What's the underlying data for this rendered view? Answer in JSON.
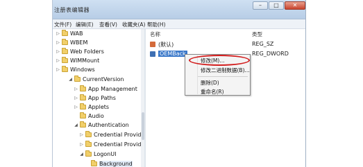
{
  "window": {
    "title": "注册表编辑器",
    "controls": {
      "minimize": "–",
      "maximize": "□",
      "close": "✕"
    }
  },
  "menubar": [
    "文件(F)",
    "编辑(E)",
    "查看(V)",
    "收藏夹(A)",
    "帮助(H)"
  ],
  "tree": {
    "items": [
      {
        "label": "WAB",
        "twisty": "▷"
      },
      {
        "label": "WBEM",
        "twisty": "▷"
      },
      {
        "label": "Web Folders",
        "twisty": "▷"
      },
      {
        "label": "WIMMount",
        "twisty": "▷"
      },
      {
        "label": "Windows",
        "twisty": "▷"
      },
      {
        "label": "CurrentVersion",
        "twisty": "◢"
      },
      {
        "label": "App Management",
        "twisty": "▷"
      },
      {
        "label": "App Paths",
        "twisty": "▷"
      },
      {
        "label": "Applets",
        "twisty": "▷"
      },
      {
        "label": "Audio",
        "twisty": ""
      },
      {
        "label": "Authentication",
        "twisty": "◢"
      },
      {
        "label": "Credential Provide",
        "twisty": "▷"
      },
      {
        "label": "Credential Provide",
        "twisty": "▷"
      },
      {
        "label": "LogonUI",
        "twisty": "◢"
      },
      {
        "label": "Background",
        "twisty": ""
      }
    ]
  },
  "list": {
    "headers": {
      "name": "名称",
      "type": "类型"
    },
    "rows": [
      {
        "name": "(默认)",
        "type": "REG_SZ",
        "icon": "string-value-icon",
        "icon_color": "#d46a3a"
      },
      {
        "name": "OEMBack",
        "type": "REG_DWORD",
        "icon": "binary-value-icon",
        "icon_color": "#3e6fb3"
      }
    ]
  },
  "context_menu": {
    "items": [
      "修改(M)...",
      "修改二进制数据(B)...",
      "删除(D)",
      "重命名(R)"
    ],
    "highlight_color": "#d21d1d"
  }
}
